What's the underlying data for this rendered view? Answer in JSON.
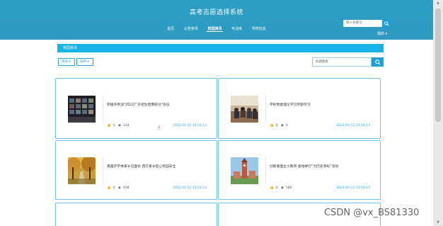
{
  "site": {
    "title": "高考志愿选择系统"
  },
  "nav": {
    "items": [
      "首页",
      "公告资讯",
      "校园资讯",
      "专业库",
      "学校信息"
    ],
    "active_index": 2
  },
  "header_search": {
    "placeholder": "输入关键词",
    "button_icon": "search-icon"
  },
  "user": {
    "label": "我的 ▾"
  },
  "section": {
    "title": "校园资讯"
  },
  "filters": {
    "dropdown1": "筛选 ▾",
    "dropdown2": "排序 ▾"
  },
  "search": {
    "placeholder": "标题搜索",
    "button_icon": "search-icon"
  },
  "cards": [
    {
      "title": "积極开参加\"2022广东招生政策研讨\"会议",
      "likes": "1",
      "views": "334",
      "date": "2022-05-12 15:51:13",
      "thumb": "meeting-screen"
    },
    {
      "title": "学校党委理论学习专题学习",
      "likes": "0",
      "views": "0",
      "date": "2022-05-12 15:51:13",
      "thumb": "classroom"
    },
    {
      "title": "美国开学季家长见面会 西方家长担心校园安全",
      "likes": "0",
      "views": "938",
      "date": "2022-05-12 15:51:13",
      "thumb": "autumn-road"
    },
    {
      "title": "创新爱国主义教育 各地举行\"为历史添彩\"活动",
      "likes": "0",
      "views": "580",
      "date": "2022-05-12 15:51:13",
      "thumb": "tower"
    }
  ],
  "watermark": {
    "text": "CSDN @vx_BS81330"
  },
  "colors": {
    "header": "#2e9dc2",
    "accent": "#15b3e6",
    "card_border": "#6cc3e6",
    "date": "#27a6d8"
  }
}
